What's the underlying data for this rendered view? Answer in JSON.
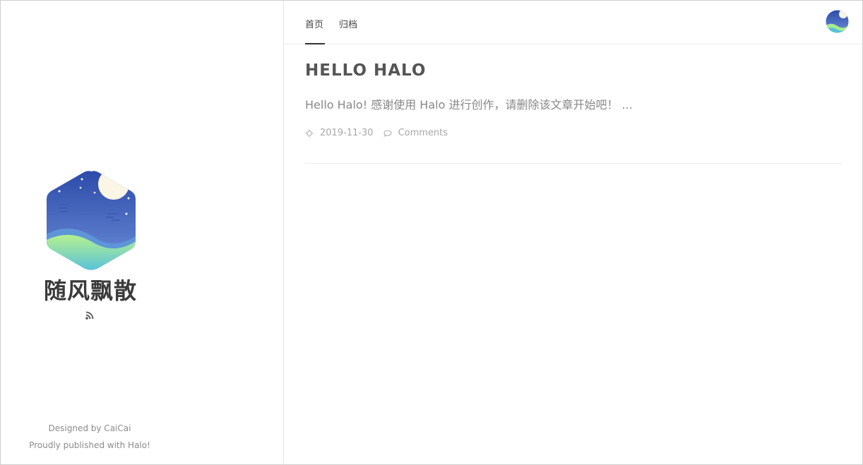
{
  "sidebar": {
    "site_title": "随风飘散",
    "footer_designed": "Designed by CaiCai",
    "footer_published": "Proudly published with Halo!"
  },
  "nav": {
    "items": [
      {
        "label": "首页",
        "active": true
      },
      {
        "label": "归档",
        "active": false
      }
    ]
  },
  "post": {
    "title": "HELLO HALO",
    "excerpt": "Hello Halo! 感谢使用 Halo 进行创作，请删除该文章开始吧！ ...",
    "date": "2019-11-30",
    "comments_label": "Comments"
  },
  "colors": {
    "logo_sky": "#4c6fc5",
    "logo_moon": "#fbf5e6",
    "logo_hill": "#a8ec8f",
    "text_muted": "#a8a8a8"
  },
  "icons": [
    "rss-icon",
    "sun-icon",
    "comment-icon",
    "avatar-logo-icon",
    "site-logo-icon"
  ]
}
